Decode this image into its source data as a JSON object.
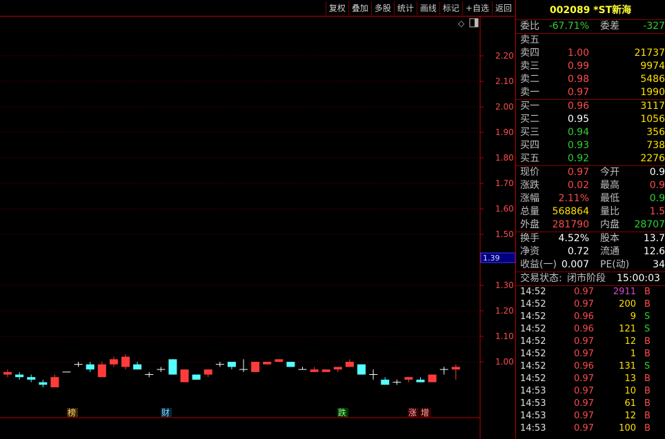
{
  "toolbar": {
    "buttons": [
      "复权",
      "叠加",
      "多股",
      "统计",
      "画线",
      "标记",
      "+自选",
      "返回"
    ]
  },
  "chart": {
    "price_labels": [
      "2.20",
      "2.10",
      "2.00",
      "1.90",
      "1.80",
      "1.70",
      "1.60",
      "1.50",
      "1.30",
      "1.20",
      "1.10",
      "1.00"
    ],
    "current_marker": "1.39",
    "event_tags": [
      "榜",
      "财",
      "跌",
      "涨",
      "增"
    ],
    "colors": {
      "up": "#ff3b3b",
      "down": "#54ffff",
      "grid": "#7a0000",
      "axis": "#c00000"
    }
  },
  "chart_data": {
    "type": "candlestick",
    "price_axis": {
      "min": 0.9,
      "max": 2.3
    },
    "candles": [
      {
        "o": 0.95,
        "c": 0.96,
        "h": 0.97,
        "l": 0.94
      },
      {
        "o": 0.95,
        "c": 0.94,
        "h": 0.96,
        "l": 0.93
      },
      {
        "o": 0.94,
        "c": 0.93,
        "h": 0.95,
        "l": 0.92
      },
      {
        "o": 0.92,
        "c": 0.91,
        "h": 0.93,
        "l": 0.9
      },
      {
        "o": 0.9,
        "c": 0.94,
        "h": 0.95,
        "l": 0.9
      },
      {
        "o": 0.96,
        "c": 0.96,
        "h": 0.96,
        "l": 0.96
      },
      {
        "o": 0.99,
        "c": 0.99,
        "h": 1.0,
        "l": 0.98
      },
      {
        "o": 0.99,
        "c": 0.97,
        "h": 1.0,
        "l": 0.96
      },
      {
        "o": 0.94,
        "c": 0.99,
        "h": 1.0,
        "l": 0.94
      },
      {
        "o": 0.99,
        "c": 1.01,
        "h": 1.02,
        "l": 0.98
      },
      {
        "o": 0.98,
        "c": 1.02,
        "h": 1.03,
        "l": 0.97
      },
      {
        "o": 0.99,
        "c": 0.97,
        "h": 1.0,
        "l": 0.97
      },
      {
        "o": 0.95,
        "c": 0.95,
        "h": 0.96,
        "l": 0.94
      },
      {
        "o": 0.97,
        "c": 0.97,
        "h": 0.98,
        "l": 0.96
      },
      {
        "o": 1.01,
        "c": 0.95,
        "h": 1.01,
        "l": 0.95
      },
      {
        "o": 0.92,
        "c": 0.97,
        "h": 0.97,
        "l": 0.92
      },
      {
        "o": 0.95,
        "c": 0.93,
        "h": 0.95,
        "l": 0.93
      },
      {
        "o": 0.95,
        "c": 0.97,
        "h": 0.97,
        "l": 0.94
      },
      {
        "o": 0.99,
        "c": 0.99,
        "h": 1.0,
        "l": 0.98
      },
      {
        "o": 1.0,
        "c": 0.98,
        "h": 1.0,
        "l": 0.97
      },
      {
        "o": 0.97,
        "c": 0.97,
        "h": 1.01,
        "l": 0.96
      },
      {
        "o": 0.96,
        "c": 1.0,
        "h": 1.0,
        "l": 0.96
      },
      {
        "o": 0.99,
        "c": 1.0,
        "h": 1.0,
        "l": 0.99
      },
      {
        "o": 1.0,
        "c": 1.01,
        "h": 1.01,
        "l": 1.0
      },
      {
        "o": 1.0,
        "c": 0.98,
        "h": 1.0,
        "l": 0.98
      },
      {
        "o": 0.97,
        "c": 0.97,
        "h": 0.98,
        "l": 0.97
      },
      {
        "o": 0.96,
        "c": 0.97,
        "h": 0.98,
        "l": 0.96
      },
      {
        "o": 0.96,
        "c": 0.97,
        "h": 0.97,
        "l": 0.96
      },
      {
        "o": 0.97,
        "c": 0.98,
        "h": 0.98,
        "l": 0.96
      },
      {
        "o": 0.98,
        "c": 1.0,
        "h": 1.01,
        "l": 0.98
      },
      {
        "o": 0.99,
        "c": 0.95,
        "h": 0.99,
        "l": 0.95
      },
      {
        "o": 0.95,
        "c": 0.95,
        "h": 0.97,
        "l": 0.93
      },
      {
        "o": 0.93,
        "c": 0.91,
        "h": 0.94,
        "l": 0.91
      },
      {
        "o": 0.92,
        "c": 0.92,
        "h": 0.93,
        "l": 0.91
      },
      {
        "o": 0.93,
        "c": 0.94,
        "h": 0.94,
        "l": 0.92
      },
      {
        "o": 0.93,
        "c": 0.92,
        "h": 0.94,
        "l": 0.92
      },
      {
        "o": 0.92,
        "c": 0.95,
        "h": 0.95,
        "l": 0.92
      },
      {
        "o": 0.97,
        "c": 0.97,
        "h": 0.98,
        "l": 0.95
      },
      {
        "o": 0.97,
        "c": 0.98,
        "h": 0.99,
        "l": 0.93
      }
    ]
  },
  "panel": {
    "title": "002089 *ST新海",
    "weibi": {
      "label": "委比",
      "value": "-67.71%",
      "label2": "委差",
      "value2": "-327"
    },
    "sells": [
      {
        "label": "卖五",
        "price": "",
        "vol": ""
      },
      {
        "label": "卖四",
        "price": "1.00",
        "vol": "21737"
      },
      {
        "label": "卖三",
        "price": "0.99",
        "vol": "9974"
      },
      {
        "label": "卖二",
        "price": "0.98",
        "vol": "5486"
      },
      {
        "label": "卖一",
        "price": "0.97",
        "vol": "1990"
      }
    ],
    "buys": [
      {
        "label": "买一",
        "price": "0.96",
        "vol": "3117"
      },
      {
        "label": "买二",
        "price": "0.95",
        "vol": "1056"
      },
      {
        "label": "买三",
        "price": "0.94",
        "vol": "356"
      },
      {
        "label": "买四",
        "price": "0.93",
        "vol": "738"
      },
      {
        "label": "买五",
        "price": "0.92",
        "vol": "2276"
      }
    ],
    "stats1": [
      {
        "l1": "现价",
        "v1": "0.97",
        "l2": "今开",
        "v2": "0.9"
      },
      {
        "l1": "涨跌",
        "v1": "0.02",
        "l2": "最高",
        "v2": "0.9"
      },
      {
        "l1": "涨幅",
        "v1": "2.11%",
        "l2": "最低",
        "v2": "0.9"
      },
      {
        "l1": "总量",
        "v1": "568864",
        "l2": "量比",
        "v2": "1.5"
      },
      {
        "l1": "外盘",
        "v1": "281790",
        "l2": "内盘",
        "v2": "28707"
      }
    ],
    "stats2": [
      {
        "l1": "换手",
        "v1": "4.52%",
        "l2": "股本",
        "v2": "13.7"
      },
      {
        "l1": "净资",
        "v1": "0.72",
        "l2": "流通",
        "v2": "12.6"
      },
      {
        "l1": "收益(一)",
        "v1": "0.007",
        "l2": "PE(动)",
        "v2": "34"
      }
    ],
    "trade_status": {
      "label": "交易状态:",
      "value": "闭市阶段",
      "time": "15:00:03"
    },
    "ticks": [
      {
        "time": "14:52",
        "price": "0.97",
        "vol": "2911",
        "bs": "B"
      },
      {
        "time": "14:52",
        "price": "0.97",
        "vol": "200",
        "bs": "B"
      },
      {
        "time": "14:52",
        "price": "0.96",
        "vol": "9",
        "bs": "S"
      },
      {
        "time": "14:52",
        "price": "0.96",
        "vol": "121",
        "bs": "S"
      },
      {
        "time": "14:52",
        "price": "0.97",
        "vol": "12",
        "bs": "B"
      },
      {
        "time": "14:52",
        "price": "0.97",
        "vol": "1",
        "bs": "B"
      },
      {
        "time": "14:52",
        "price": "0.96",
        "vol": "131",
        "bs": "S"
      },
      {
        "time": "14:52",
        "price": "0.97",
        "vol": "13",
        "bs": "B"
      },
      {
        "time": "14:53",
        "price": "0.97",
        "vol": "10",
        "bs": "B"
      },
      {
        "time": "14:53",
        "price": "0.97",
        "vol": "61",
        "bs": "B"
      },
      {
        "time": "14:53",
        "price": "0.97",
        "vol": "12",
        "bs": "B"
      },
      {
        "time": "14:53",
        "price": "0.97",
        "vol": "100",
        "bs": "B"
      }
    ]
  }
}
